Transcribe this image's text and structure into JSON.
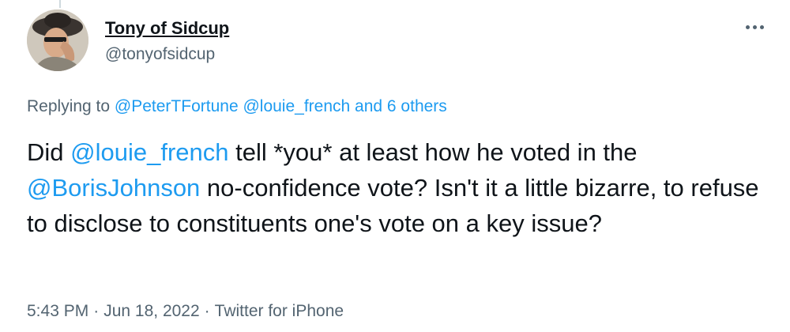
{
  "user": {
    "display_name": "Tony of Sidcup",
    "handle": "@tonyofsidcup"
  },
  "reply_context": {
    "prefix": "Replying to",
    "mentions": [
      "@PeterTFortune",
      "@louie_french"
    ],
    "others": "and 6 others"
  },
  "tweet": {
    "t0": "Did ",
    "mention1": "@louie_french",
    "t1": " tell *you* at least how he voted in the ",
    "mention2": "@BorisJohnson",
    "t2": " no-confidence vote? Isn't it a little bizarre, to refuse to disclose to constituents one's vote on a key issue?"
  },
  "meta": {
    "time": "5:43 PM",
    "separator": "·",
    "date": "Jun 18, 2022",
    "source": "Twitter for iPhone"
  },
  "icons": {
    "more": "more-horizontal-icon"
  },
  "colors": {
    "link": "#1d9bf0",
    "text": "#0f1419",
    "secondary": "#536471"
  }
}
